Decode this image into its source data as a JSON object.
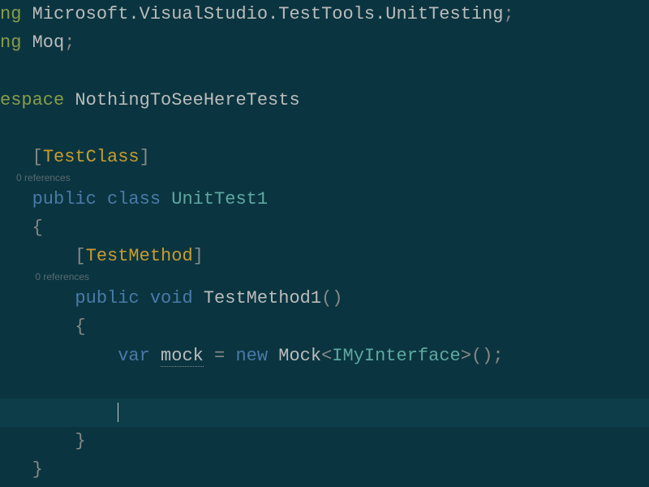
{
  "code": {
    "using1_kw": "ng",
    "using1_ns": " Microsoft.VisualStudio.TestTools.UnitTesting",
    "using1_semi": ";",
    "using2_kw": "ng",
    "using2_ns": " Moq",
    "using2_semi": ";",
    "ns_kw": "espace",
    "ns_name": " NothingToSeeHereTests",
    "attr_open1": "[",
    "attr_testclass": "TestClass",
    "attr_close1": "]",
    "codelens1": "0 references",
    "public1": "public",
    "class_kw": " class ",
    "classname": "UnitTest1",
    "brace_open1": "{",
    "attr_open2": "[",
    "attr_testmethod": "TestMethod",
    "attr_close2": "]",
    "codelens2": "0 references",
    "public2": "public",
    "void_kw": " void ",
    "methodname": "TestMethod1",
    "method_parens": "()",
    "brace_open2": "{",
    "var_kw": "var",
    "var_name": " mock",
    "eq": " = ",
    "new_kw": "new",
    "mock_type": " Mock",
    "angle_open": "<",
    "interface_name": "IMyInterface",
    "angle_close": ">",
    "call_parens": "();",
    "brace_close2": "}",
    "brace_close1": "}"
  }
}
